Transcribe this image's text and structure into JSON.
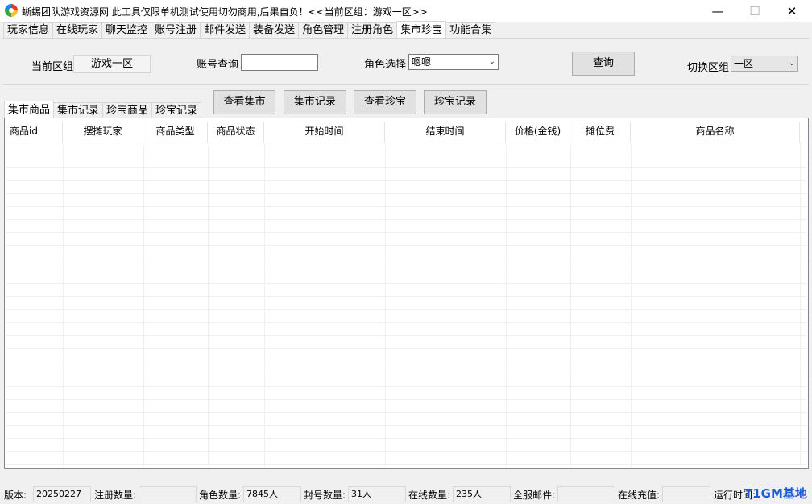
{
  "window": {
    "title": "蜥蜴团队游戏资源网 此工具仅限单机测试使用切勿商用,后果自负！<<当前区组：游戏一区>>",
    "minimize_glyph": "—",
    "maximize_glyph": "☐",
    "close_glyph": "✕"
  },
  "menu_tabs": [
    "玩家信息",
    "在线玩家",
    "聊天监控",
    "账号注册",
    "邮件发送",
    "装备发送",
    "角色管理",
    "注册角色",
    "集市珍宝",
    "功能合集"
  ],
  "active_menu_tab": "集市珍宝",
  "controls": {
    "current_zone_label": "当前区组",
    "current_zone_value": "游戏一区",
    "account_query_label": "账号查询",
    "account_query_value": "",
    "role_select_label": "角色选择",
    "role_select_value": "嗯嗯",
    "query_button": "查询",
    "switch_zone_label": "切换区组",
    "switch_zone_value": "一区"
  },
  "action_buttons": [
    "查看集市",
    "集市记录",
    "查看珍宝",
    "珍宝记录"
  ],
  "sub_tabs": [
    "集市商品",
    "集市记录",
    "珍宝商品",
    "珍宝记录"
  ],
  "active_sub_tab": "集市商品",
  "table": {
    "columns": [
      "商品id",
      "摆摊玩家",
      "商品类型",
      "商品状态",
      "开始时间",
      "结束时间",
      "价格(金钱)",
      "摊位费",
      "商品名称"
    ],
    "rows": []
  },
  "status": {
    "version_label": "版本:",
    "version_value": "20250227",
    "register_count_label": "注册数量:",
    "register_count_value": "",
    "role_count_label": "角色数量:",
    "role_count_value": "7845人",
    "banned_count_label": "封号数量:",
    "banned_count_value": "31人",
    "online_count_label": "在线数量:",
    "online_count_value": "235人",
    "server_mail_label": "全服邮件:",
    "server_mail_value": "",
    "online_recharge_label": "在线充值:",
    "online_recharge_value": "",
    "run_time_label": "运行时间:"
  },
  "watermark": "T1GM基地",
  "colors": {
    "window_bg": "#f0f0f0",
    "watermark": "#1e5bd6"
  }
}
